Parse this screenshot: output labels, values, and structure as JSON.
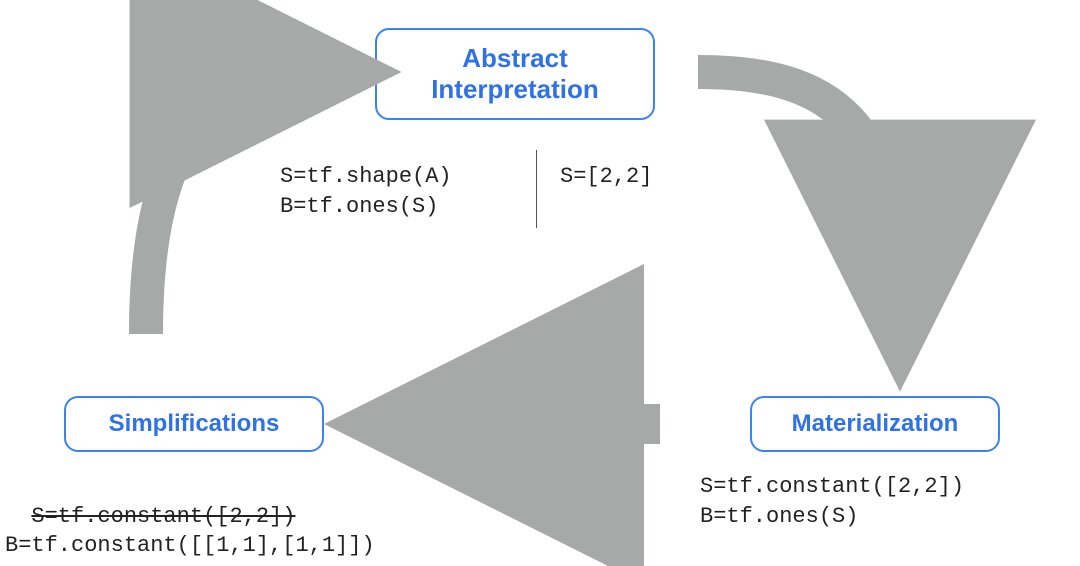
{
  "nodes": {
    "abstract": {
      "line1": "Abstract",
      "line2": "Interpretation"
    },
    "materialization": "Materialization",
    "simplifications": "Simplifications"
  },
  "center_code": {
    "left": "S=tf.shape(A)\nB=tf.ones(S)",
    "right": "S=[2,2]"
  },
  "materialization_code": "S=tf.constant([2,2])\nB=tf.ones(S)",
  "simplifications_code": {
    "strike": "S=tf.constant([2,2])",
    "plain": "B=tf.constant([[1,1],[1,1]])"
  },
  "colors": {
    "arrow": "#a7a8a8",
    "box_border": "#3b82f6",
    "box_text": "#2f72e6"
  }
}
